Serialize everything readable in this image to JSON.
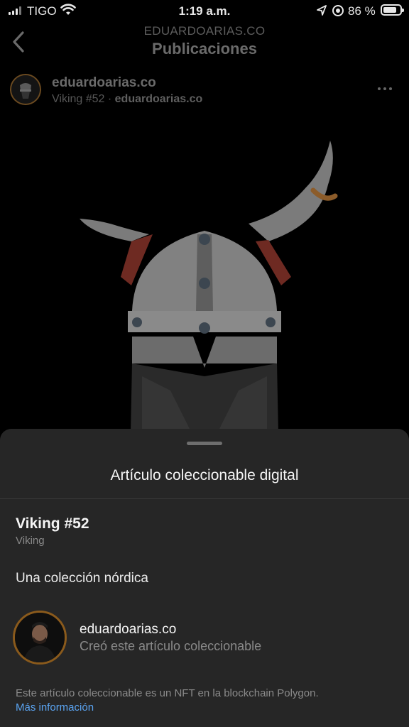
{
  "status_bar": {
    "carrier": "TIGO",
    "time": "1:19 a.m.",
    "battery_percent": "86 %",
    "icons": [
      "signal-icon",
      "wifi-icon",
      "location-arrow-icon",
      "alarm-icon",
      "battery-icon"
    ]
  },
  "nav": {
    "account": "EDUARDOARIAS.CO",
    "title": "Publicaciones",
    "back_icon": "chevron-left-icon"
  },
  "post": {
    "username": "eduardoarias.co",
    "item": "Viking #52",
    "separator": " · ",
    "owner": "eduardoarias.co",
    "more_icon": "ellipsis-icon",
    "image": "viking-helmet-artwork"
  },
  "sheet": {
    "title": "Artículo coleccionable digital",
    "item_name": "Viking #52",
    "collection": "Viking",
    "description": "Una colección nórdica",
    "creator_name": "eduardoarias.co",
    "creator_role": "Creó este artículo coleccionable",
    "footer_note": "Este artículo coleccionable es un NFT en la blockchain Polygon.",
    "more_info": "Más información"
  },
  "colors": {
    "background": "#000000",
    "sheet": "#262626",
    "link": "#5aa3f0",
    "avatar_ring": "#8a5a1c"
  }
}
